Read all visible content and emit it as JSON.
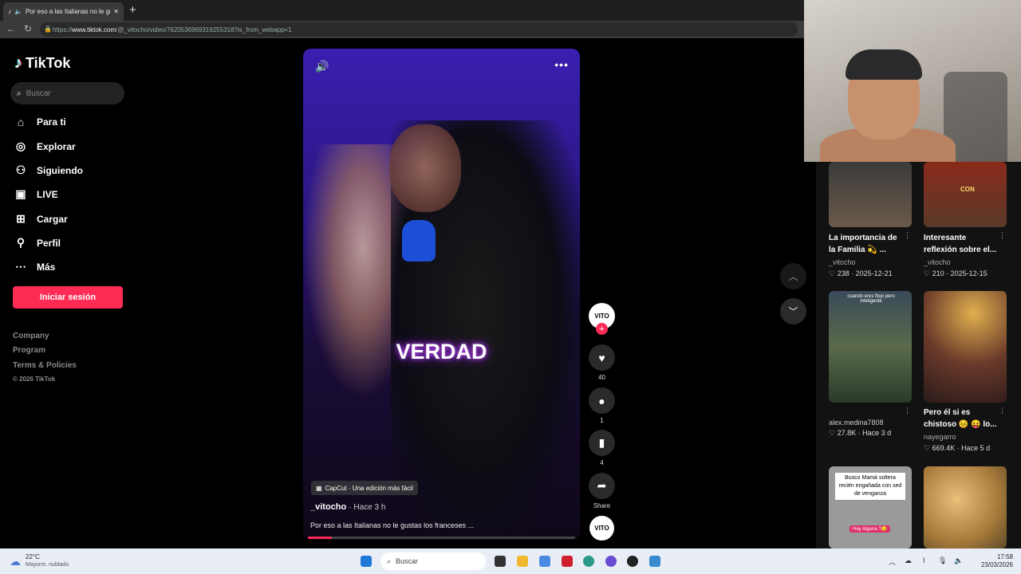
{
  "browser": {
    "tab_title": "Por eso a las Italianas no le gu",
    "url_prefix": "https://",
    "url_domain": "www.tiktok.com",
    "url_path": "/@_vitocho/video/7620536969319255318?is_from_webapp=1"
  },
  "sidebar": {
    "logo": "TikTok",
    "search_placeholder": "Buscar",
    "items": [
      {
        "label": "Para ti",
        "icon": "home-icon"
      },
      {
        "label": "Explorar",
        "icon": "compass-icon"
      },
      {
        "label": "Siguiendo",
        "icon": "following-icon"
      },
      {
        "label": "LIVE",
        "icon": "live-icon"
      },
      {
        "label": "Cargar",
        "icon": "upload-icon"
      },
      {
        "label": "Perfil",
        "icon": "profile-icon"
      },
      {
        "label": "Más",
        "icon": "more-icon"
      }
    ],
    "login_button": "Iniciar sesión",
    "footer": [
      "Company",
      "Program",
      "Terms & Policies"
    ],
    "copyright": "© 2026 TikTok"
  },
  "video": {
    "overlay_text": "VERDAD",
    "capcut_label": "CapCut · Una edición más fácil",
    "author": "_vitocho",
    "time": "· Hace 3 h",
    "description": "Por eso a las Italianas no le gustas los franceses ...",
    "progress": 0.09
  },
  "actions": {
    "avatar_label": "VITO",
    "likes": "40",
    "comments": "1",
    "saves": "4",
    "share": "Share"
  },
  "recommendations": [
    {
      "caption": "La importancia de la Familia 💫 ...",
      "author": "_vitocho",
      "likes": "238",
      "date": "2025-12-21",
      "thumb_color": "#5a4a3a"
    },
    {
      "caption": "Interesante reflexión sobre el...",
      "author": "_vitocho",
      "likes": "210",
      "date": "2025-12-15",
      "thumb_color": "#7a2a1a",
      "thumb_text": "CON"
    },
    {
      "caption": "",
      "author": "alex.medina7808",
      "likes": "27.8K",
      "date": "Hace 3 d",
      "thumb_color": "#4a5a3a",
      "thumb_text": "cuando eres flojo pero inteligente"
    },
    {
      "caption": "Pero él si es chistoso 😣 😝 lo...",
      "author": "nayegarro",
      "likes": "669.4K",
      "date": "Hace 5 d",
      "thumb_color": "#6a3a2a"
    },
    {
      "caption": "",
      "author": "",
      "likes": "",
      "date": "",
      "thumb_color": "#9a9a9a",
      "thumb_text": "Busco Mamá soltera recién engañada con sed de venganza",
      "thumb_sub": "Hay Alguna ?😏"
    },
    {
      "caption": "",
      "author": "",
      "likes": "",
      "date": "",
      "thumb_color": "#c89a5a"
    }
  ],
  "taskbar": {
    "temp": "22°C",
    "weather": "Mayorm. nublado",
    "search": "Buscar",
    "time": "17:58",
    "date": "23/03/2026"
  }
}
